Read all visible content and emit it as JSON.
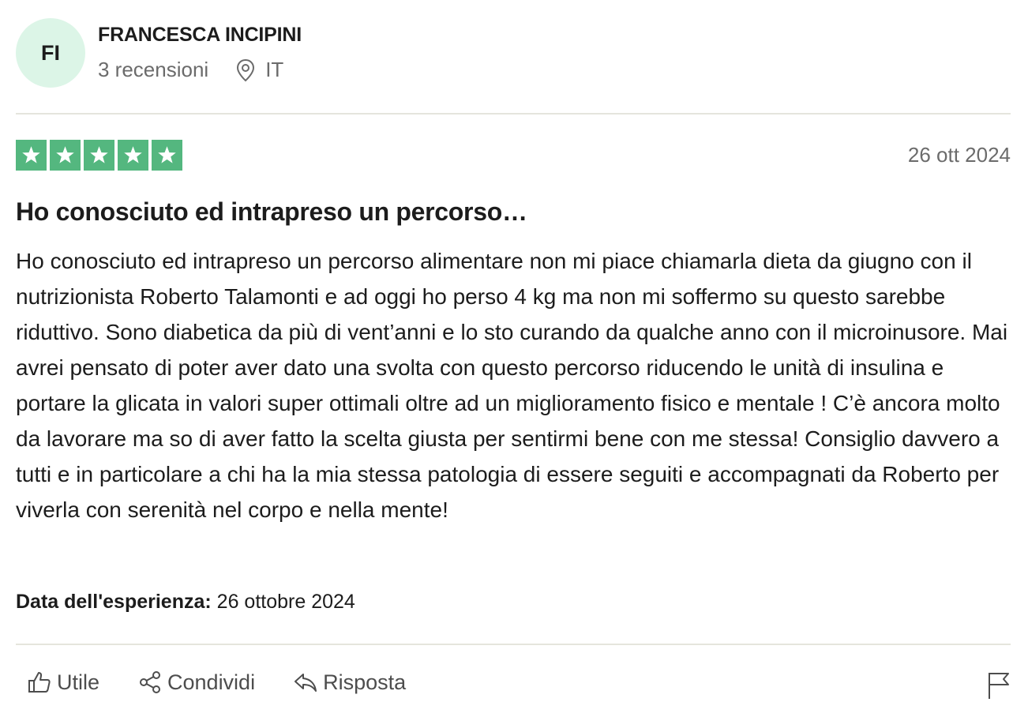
{
  "reviewer": {
    "initials": "FI",
    "name": "FRANCESCA INCIPINI",
    "reviews_count": "3 recensioni",
    "country": "IT",
    "avatar_bg": "#dcf5e7"
  },
  "review": {
    "rating": 5,
    "max_rating": 5,
    "star_color": "#54b77f",
    "date": "26 ott 2024",
    "title": "Ho conosciuto ed intrapreso un percorso…",
    "body": "Ho conosciuto ed intrapreso un percorso alimentare non mi piace chiamarla dieta da giugno con il nutrizionista Roberto Talamonti e ad oggi ho perso 4 kg ma non mi soffermo su questo sarebbe riduttivo. Sono diabetica da più di vent’anni e lo sto curando da qualche anno con il microinusore. Mai avrei pensato di poter aver dato una svolta con questo percorso riducendo le unità di insulina e portare la glicata in valori super ottimali oltre ad un miglioramento fisico e mentale ! C’è ancora molto da lavorare ma so di aver fatto la scelta giusta per sentirmi bene con me stessa! Consiglio davvero a tutti e in particolare a chi ha la mia stessa patologia di essere seguiti e accompagnati da Roberto per viverla con serenità nel corpo e nella mente!",
    "experience_label": "Data dell'esperienza:",
    "experience_date": "26 ottobre 2024"
  },
  "actions": {
    "useful": {
      "label": "Utile",
      "icon": "thumbs-up-icon"
    },
    "share": {
      "label": "Condividi",
      "icon": "share-icon"
    },
    "reply": {
      "label": "Risposta",
      "icon": "reply-icon"
    },
    "report": {
      "icon": "flag-icon"
    }
  }
}
